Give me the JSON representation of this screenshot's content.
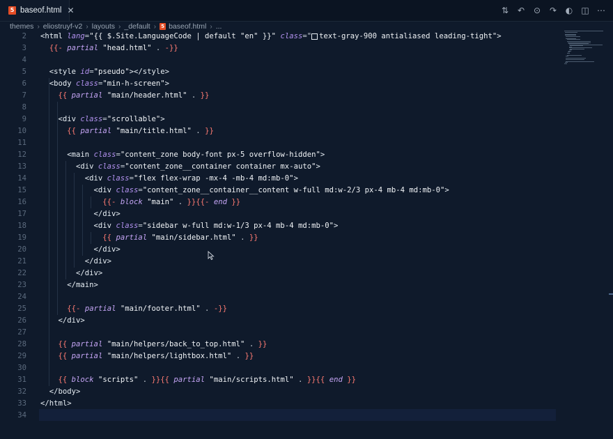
{
  "tab": {
    "label": "baseof.html",
    "icon": "html5-icon"
  },
  "breadcrumb": [
    "themes",
    "eliostruyf-v2",
    "layouts",
    "_default",
    "baseof.html",
    "..."
  ],
  "actions": [
    "source-control-icon",
    "go-back-icon",
    "circle-dot-icon",
    "go-forward-icon",
    "run-icon",
    "split-editor-icon",
    "more-icon"
  ],
  "lines": [
    {
      "n": "2",
      "segs": [
        [
          "tag",
          "<html "
        ],
        [
          "attr",
          "lang"
        ],
        [
          "op",
          "="
        ],
        [
          "str",
          "\"{{ $.Site.LanguageCode | default \"en\" }}\""
        ],
        [
          "op",
          " "
        ],
        [
          "attr",
          "class"
        ],
        [
          "op",
          "=\""
        ],
        [
          "box",
          ""
        ],
        [
          "str",
          "text-gray-900 antialiased leading-tight\""
        ],
        [
          "tag",
          ">"
        ]
      ]
    },
    {
      "n": "3",
      "segs": [
        [
          "op",
          "  "
        ],
        [
          "tpl",
          "{{-"
        ],
        [
          "op",
          " "
        ],
        [
          "kw",
          "partial"
        ],
        [
          "op",
          " "
        ],
        [
          "str",
          "\"head.html\""
        ],
        [
          "op",
          " . "
        ],
        [
          "tpl",
          "-}}"
        ]
      ]
    },
    {
      "n": "4",
      "segs": []
    },
    {
      "n": "5",
      "segs": [
        [
          "op",
          "  "
        ],
        [
          "tag",
          "<style "
        ],
        [
          "attr",
          "id"
        ],
        [
          "op",
          "="
        ],
        [
          "str",
          "\"pseudo\""
        ],
        [
          "tag",
          "></style>"
        ]
      ]
    },
    {
      "n": "6",
      "segs": [
        [
          "op",
          "  "
        ],
        [
          "tag",
          "<body "
        ],
        [
          "attr",
          "class"
        ],
        [
          "op",
          "="
        ],
        [
          "str",
          "\"min-h-screen\""
        ],
        [
          "tag",
          ">"
        ]
      ]
    },
    {
      "n": "7",
      "segs": [
        [
          "op",
          "    "
        ],
        [
          "tpl",
          "{{"
        ],
        [
          "op",
          " "
        ],
        [
          "kw",
          "partial"
        ],
        [
          "op",
          " "
        ],
        [
          "str",
          "\"main/header.html\""
        ],
        [
          "op",
          " . "
        ],
        [
          "tpl",
          "}}"
        ]
      ]
    },
    {
      "n": "8",
      "segs": []
    },
    {
      "n": "9",
      "segs": [
        [
          "op",
          "    "
        ],
        [
          "tag",
          "<div "
        ],
        [
          "attr",
          "class"
        ],
        [
          "op",
          "="
        ],
        [
          "str",
          "\"scrollable\""
        ],
        [
          "tag",
          ">"
        ]
      ]
    },
    {
      "n": "10",
      "segs": [
        [
          "op",
          "      "
        ],
        [
          "tpl",
          "{{"
        ],
        [
          "op",
          " "
        ],
        [
          "kw",
          "partial"
        ],
        [
          "op",
          " "
        ],
        [
          "str",
          "\"main/title.html\""
        ],
        [
          "op",
          " . "
        ],
        [
          "tpl",
          "}}"
        ]
      ]
    },
    {
      "n": "11",
      "segs": []
    },
    {
      "n": "12",
      "segs": [
        [
          "op",
          "      "
        ],
        [
          "tag",
          "<main "
        ],
        [
          "attr",
          "class"
        ],
        [
          "op",
          "="
        ],
        [
          "str",
          "\"content_zone body-font px-5 overflow-hidden\""
        ],
        [
          "tag",
          ">"
        ]
      ]
    },
    {
      "n": "13",
      "segs": [
        [
          "op",
          "        "
        ],
        [
          "tag",
          "<div "
        ],
        [
          "attr",
          "class"
        ],
        [
          "op",
          "="
        ],
        [
          "str",
          "\"content_zone__container container mx-auto\""
        ],
        [
          "tag",
          ">"
        ]
      ]
    },
    {
      "n": "14",
      "segs": [
        [
          "op",
          "          "
        ],
        [
          "tag",
          "<div "
        ],
        [
          "attr",
          "class"
        ],
        [
          "op",
          "="
        ],
        [
          "str",
          "\"flex flex-wrap -mx-4 -mb-4 md:mb-0\""
        ],
        [
          "tag",
          ">"
        ]
      ]
    },
    {
      "n": "15",
      "segs": [
        [
          "op",
          "            "
        ],
        [
          "tag",
          "<div "
        ],
        [
          "attr",
          "class"
        ],
        [
          "op",
          "="
        ],
        [
          "str",
          "\"content_zone__container__content w-full md:w-2/3 px-4 mb-4 md:mb-0\""
        ],
        [
          "tag",
          ">"
        ]
      ]
    },
    {
      "n": "16",
      "segs": [
        [
          "op",
          "              "
        ],
        [
          "tpl",
          "{{-"
        ],
        [
          "op",
          " "
        ],
        [
          "kw",
          "block"
        ],
        [
          "op",
          " "
        ],
        [
          "str",
          "\"main\""
        ],
        [
          "op",
          " . "
        ],
        [
          "tpl",
          "}}{{-"
        ],
        [
          "op",
          " "
        ],
        [
          "kw",
          "end"
        ],
        [
          "op",
          " "
        ],
        [
          "tpl",
          "}}"
        ]
      ]
    },
    {
      "n": "17",
      "segs": [
        [
          "op",
          "            "
        ],
        [
          "tag",
          "</div>"
        ]
      ]
    },
    {
      "n": "18",
      "segs": [
        [
          "op",
          "            "
        ],
        [
          "tag",
          "<div "
        ],
        [
          "attr",
          "class"
        ],
        [
          "op",
          "="
        ],
        [
          "str",
          "\"sidebar w-full md:w-1/3 px-4 mb-4 md:mb-0\""
        ],
        [
          "tag",
          ">"
        ]
      ]
    },
    {
      "n": "19",
      "segs": [
        [
          "op",
          "              "
        ],
        [
          "tpl",
          "{{"
        ],
        [
          "op",
          " "
        ],
        [
          "kw",
          "partial"
        ],
        [
          "op",
          " "
        ],
        [
          "str",
          "\"main/sidebar.html\""
        ],
        [
          "op",
          " . "
        ],
        [
          "tpl",
          "}}"
        ]
      ]
    },
    {
      "n": "20",
      "segs": [
        [
          "op",
          "            "
        ],
        [
          "tag",
          "</div>"
        ]
      ]
    },
    {
      "n": "21",
      "segs": [
        [
          "op",
          "          "
        ],
        [
          "tag",
          "</div>"
        ]
      ]
    },
    {
      "n": "22",
      "segs": [
        [
          "op",
          "        "
        ],
        [
          "tag",
          "</div>"
        ]
      ]
    },
    {
      "n": "23",
      "segs": [
        [
          "op",
          "      "
        ],
        [
          "tag",
          "</main>"
        ]
      ]
    },
    {
      "n": "24",
      "segs": []
    },
    {
      "n": "25",
      "segs": [
        [
          "op",
          "      "
        ],
        [
          "tpl",
          "{{-"
        ],
        [
          "op",
          " "
        ],
        [
          "kw",
          "partial"
        ],
        [
          "op",
          " "
        ],
        [
          "str",
          "\"main/footer.html\""
        ],
        [
          "op",
          " . "
        ],
        [
          "tpl",
          "-}}"
        ]
      ]
    },
    {
      "n": "26",
      "segs": [
        [
          "op",
          "    "
        ],
        [
          "tag",
          "</div>"
        ]
      ]
    },
    {
      "n": "27",
      "segs": []
    },
    {
      "n": "28",
      "segs": [
        [
          "op",
          "    "
        ],
        [
          "tpl",
          "{{"
        ],
        [
          "op",
          " "
        ],
        [
          "kw",
          "partial"
        ],
        [
          "op",
          " "
        ],
        [
          "str",
          "\"main/helpers/back_to_top.html\""
        ],
        [
          "op",
          " . "
        ],
        [
          "tpl",
          "}}"
        ]
      ]
    },
    {
      "n": "29",
      "segs": [
        [
          "op",
          "    "
        ],
        [
          "tpl",
          "{{"
        ],
        [
          "op",
          " "
        ],
        [
          "kw",
          "partial"
        ],
        [
          "op",
          " "
        ],
        [
          "str",
          "\"main/helpers/lightbox.html\""
        ],
        [
          "op",
          " . "
        ],
        [
          "tpl",
          "}}"
        ]
      ]
    },
    {
      "n": "30",
      "segs": []
    },
    {
      "n": "31",
      "segs": [
        [
          "op",
          "    "
        ],
        [
          "tpl",
          "{{"
        ],
        [
          "op",
          " "
        ],
        [
          "kw",
          "block"
        ],
        [
          "op",
          " "
        ],
        [
          "str",
          "\"scripts\""
        ],
        [
          "op",
          " . "
        ],
        [
          "tpl",
          "}}{{"
        ],
        [
          "op",
          " "
        ],
        [
          "kw",
          "partial"
        ],
        [
          "op",
          " "
        ],
        [
          "str",
          "\"main/scripts.html\""
        ],
        [
          "op",
          " . "
        ],
        [
          "tpl",
          "}}{{"
        ],
        [
          "op",
          " "
        ],
        [
          "kw",
          "end"
        ],
        [
          "op",
          " "
        ],
        [
          "tpl",
          "}}"
        ]
      ]
    },
    {
      "n": "32",
      "segs": [
        [
          "op",
          "  "
        ],
        [
          "tag",
          "</body>"
        ]
      ]
    },
    {
      "n": "33",
      "segs": [
        [
          "tag",
          "</html>"
        ]
      ]
    },
    {
      "n": "34",
      "segs": []
    }
  ]
}
